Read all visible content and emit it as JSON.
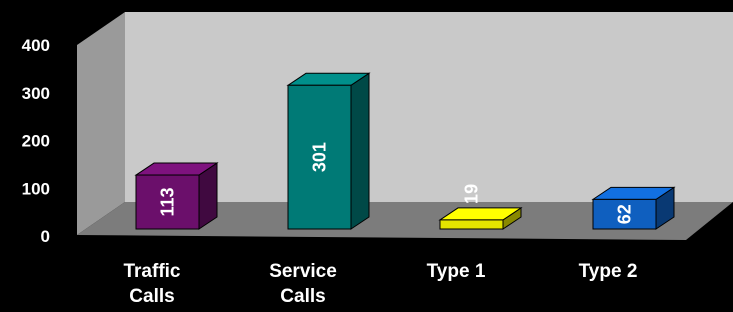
{
  "chart_data": {
    "type": "bar",
    "categories": [
      "Traffic Calls",
      "Service Calls",
      "Type 1",
      "Type 2"
    ],
    "category_lines": [
      [
        "Traffic",
        "Calls"
      ],
      [
        "Service",
        "Calls"
      ],
      [
        "Type 1"
      ],
      [
        "Type 2"
      ]
    ],
    "values": [
      113,
      301,
      19,
      62
    ],
    "data_labels": [
      "113",
      "301",
      "19",
      "62"
    ],
    "colors": [
      "#6b0f6b",
      "#007a76",
      "#e4e400",
      "#0f5fbf"
    ],
    "yticks": [
      "0",
      "100",
      "200",
      "300",
      "400"
    ],
    "ylim": [
      0,
      400
    ],
    "grid": false,
    "legend": "none"
  }
}
